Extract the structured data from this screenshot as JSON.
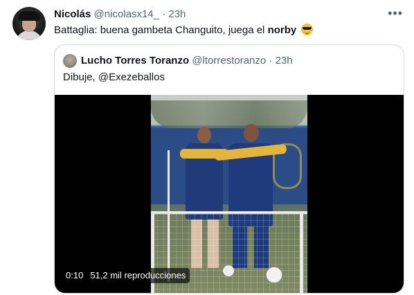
{
  "tweet": {
    "author_name": "Nicolás",
    "author_handle": "@nicolasx14_",
    "separator": "·",
    "time": "23h",
    "more_icon": "more-horizontal-icon",
    "text_before": "Battaglia: buena gambeta Changuito, juega el ",
    "text_bold": "norby",
    "emoji": "smiling-face-with-sunglasses"
  },
  "quoted": {
    "author_name": "Lucho Torres Toranzo",
    "author_handle": "@ltorrestoranzo",
    "separator": "·",
    "time": "23h",
    "text": "Dibuje, @Exezeballos",
    "video": {
      "timestamp": "0:10",
      "views": "51,2 mil reproducciones"
    }
  }
}
